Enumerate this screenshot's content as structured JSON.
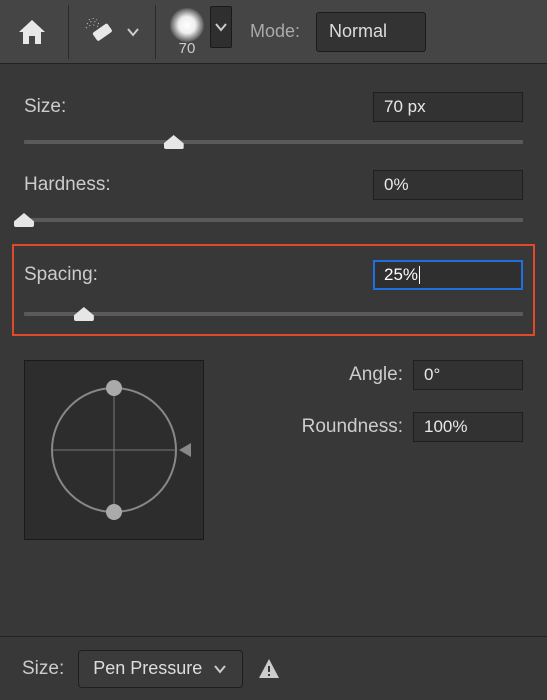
{
  "topbar": {
    "brush_preview_size": "70",
    "mode_label": "Mode:",
    "mode_value": "Normal"
  },
  "panel": {
    "size": {
      "label": "Size:",
      "value": "70 px",
      "percent": 30
    },
    "hardness": {
      "label": "Hardness:",
      "value": "0%",
      "percent": 0
    },
    "spacing": {
      "label": "Spacing:",
      "value": "25%",
      "percent": 12
    },
    "angle": {
      "label": "Angle:",
      "value": "0°"
    },
    "roundness": {
      "label": "Roundness:",
      "value": "100%"
    }
  },
  "bottom": {
    "size_label": "Size:",
    "dynamics_value": "Pen Pressure"
  }
}
